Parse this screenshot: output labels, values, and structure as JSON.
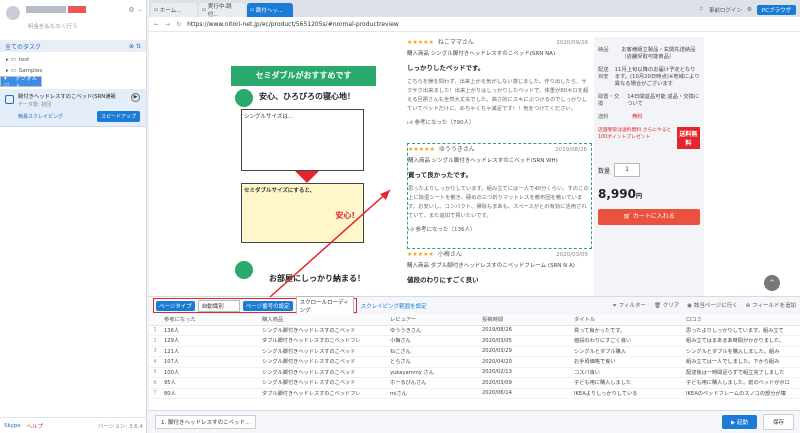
{
  "left_panel": {
    "upgrade_text": "料金を払もなく行う",
    "all_tasks_label": "全てのタスク",
    "tree": [
      {
        "label": "test"
      },
      {
        "label": "Samples"
      },
      {
        "label": "デフォルト"
      }
    ],
    "task": {
      "title": "跳付きヘッドレスすのこベッド(SRN通販",
      "status": "データ数: 初回",
      "link": "簡易スクレイピング",
      "speedup": "スピードアップ"
    },
    "footer": {
      "skype": "Skype",
      "help": "ヘルプ",
      "version": "バージョン: 3.6.4"
    }
  },
  "browser": {
    "tabs": [
      {
        "label": "ホーム..."
      },
      {
        "label": "実行中:跳付..."
      },
      {
        "label": "跳付ヘッ..."
      }
    ],
    "toolbar": {
      "login": "事前ログイン",
      "pc_mode": "PCブラウザ"
    },
    "url": "https://www.nitori-net.jp/ec/product/5651205s/#normal-productreview"
  },
  "product_image": {
    "banner": "セミダブルがおすすめです",
    "headline1": "安心、ひろびろの寝心地！",
    "single_label": "シングルサイズは…",
    "semi_label": "セミダブルサイズにすると、",
    "safe": "安心!",
    "headline2": "お部屋にしっかり納まる！"
  },
  "reviews": [
    {
      "stars": "★★★★★",
      "name": "ねこママさん",
      "date": "2020/09/26",
      "product": "購入商品 シングル脚付きヘッドレスすのこベッド(SRN NA)",
      "title": "しっかりしたベッドです。",
      "body": "こちらを暖を問わず、出来上がる気がしない感じました。作り出したら、サクサク出来ました！出来上がりはしっかりしたベッドで、体重が80キロを超える旦那さんも全然大丈夫でした。高さ的にスキにぶつけるのでしっかりしていてベッドだけに、めちゃくちゃ満足です！！気をつけてください。",
      "helpful": "参考になった（790人）"
    },
    {
      "stars": "★★★★★",
      "name": "ゆううきさん",
      "date": "2019/08/26",
      "product": "購入商品 シングル脚付きヘッドレスすのこベッド(SRN WH)",
      "title": "買って良かったです。",
      "body": "思ったよりしっかりしています。組み立てには一人で40分くらい。すのこの上に除湿シートを敷き、硬めの三つ折りマットレスを敷布団を敷いています。お安いし、コンパクト、掃除もまあも、スペースがとの有効に活用されていて、また追加で買いたいです。",
      "helpful": "参考になった（136人）"
    },
    {
      "stars": "★★★★★",
      "name": "小梅さん",
      "date": "2020/03/05",
      "product": "購入商品 ダブル脚付きヘッドレスすのこベッドフレーム (SRN N A)",
      "title": "値段のわりにすごく良い",
      "body": "",
      "helpful": ""
    }
  ],
  "side": {
    "rows": [
      {
        "k": "納品",
        "v": "お客様組立製品・玄関先送納品（店舗受取可能商品）"
      },
      {
        "k": "配送目安",
        "v": "11月上旬以降のお届け予定となります。(10月20日時点)※地域により異なる場合がございます"
      },
      {
        "k": "取置・交換",
        "v": "14日間返品可能 返品・交換について"
      },
      {
        "k": "送料",
        "v": "無料"
      }
    ],
    "promo": "店舗受取は送料無料 さらにやると100ポイントプレゼント",
    "free_badge": "送料無料",
    "qty_label": "数量",
    "qty": "1",
    "price": "8,990",
    "price_unit": "円",
    "cart": "カートに入れる"
  },
  "bar": {
    "page_type_label": "ページタイプ",
    "page_type_value": "自動識別",
    "page_flip_label": "ページ番号の設定",
    "page_flip_value": "スクロールローディング",
    "range_link": "スクレイピング範囲を設定",
    "filter": "フィルター",
    "clear": "クリア",
    "goto": "該当ページに行く",
    "add_field": "フィールドを追加"
  },
  "grid": {
    "headers": [
      "",
      "参考になった",
      "購入商品",
      "レビュアー",
      "投稿時間",
      "タイトル",
      "口コミ"
    ],
    "rows": [
      [
        "1",
        "136人",
        "シングル脚付きヘッドレスすのこベッド",
        "ゆううきさん",
        "2019/08/26",
        "買って良かったです。",
        "思ったよりしっかりしています。組み立て"
      ],
      [
        "2",
        "129人",
        "ダブル脚付きヘッドレスすのこベッドフレ",
        "小梅さん",
        "2020/03/05",
        "値段のわりにすごく良い",
        "組み立てはまあまあ時間がかかりました。"
      ],
      [
        "3",
        "121人",
        "シングル脚付きヘッドレスすのこベッド",
        "ねこさん",
        "2020/03/29",
        "シングルとダブル購入",
        "シングルとダブルを購入しました。組み"
      ],
      [
        "4",
        "107人",
        "シングル脚付きヘッドレスすのこベッド",
        "とらさん",
        "2020/04/20",
        "お手頃価格で良い",
        "組み立ては一人でしました。下から組み"
      ],
      [
        "5",
        "100人",
        "シングル脚付きヘッドレスすのこベッド",
        "yukayammy さん",
        "2020/02/13",
        "コスパ良い",
        "配達後は一時間足らずで組立完了しました"
      ],
      [
        "6",
        "95人",
        "シングル脚付きヘッドレスすのこベッド",
        "ホーるびんさん",
        "2020/03/09",
        "子ども用に購入しました",
        "子ども用に購入しました。前のベッドがボロ"
      ],
      [
        "7",
        "80人",
        "ダブル脚付きヘッドレスすのこベッドフレ",
        "miさん",
        "2020/06/14",
        "IKEAよりしっかりしている",
        "IKEAのベッドフレームのスノコの部分が壊"
      ]
    ]
  },
  "footer": {
    "task_tab": "1. 脚付きヘッドレスすのこベッド...",
    "run": "起動",
    "save": "保存"
  }
}
